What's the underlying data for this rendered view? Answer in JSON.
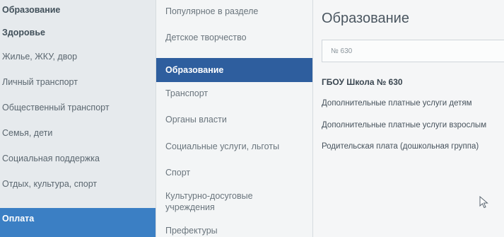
{
  "categories": [
    {
      "label": "Образование"
    },
    {
      "label": "Здоровье"
    },
    {
      "label": "Жилье, ЖКУ, двор"
    },
    {
      "label": "Личный транспорт"
    },
    {
      "label": "Общественный транспорт"
    },
    {
      "label": "Семья, дети"
    },
    {
      "label": "Социальная поддержка"
    },
    {
      "label": "Отдых, культура, спорт"
    },
    {
      "label": "Оплата"
    }
  ],
  "subcategories": [
    {
      "label": "Популярное в разделе"
    },
    {
      "label": "Детское творчество"
    },
    {
      "label": "Образование"
    },
    {
      "label": "Транспорт"
    },
    {
      "label": "Органы власти"
    },
    {
      "label": "Социальные услуги, льготы"
    },
    {
      "label": "Спорт"
    },
    {
      "label": "Культурно-досуговые учреждения"
    },
    {
      "label": "Префектуры"
    }
  ],
  "content": {
    "title": "Образование",
    "search_value": "№ 630",
    "school_name": "ГБОУ Школа № 630",
    "services": [
      {
        "label": "Дополнительные платные услуги детям"
      },
      {
        "label": "Дополнительные платные услуги взрослым"
      },
      {
        "label": "Родительская плата (дошкольная группа)"
      }
    ]
  }
}
